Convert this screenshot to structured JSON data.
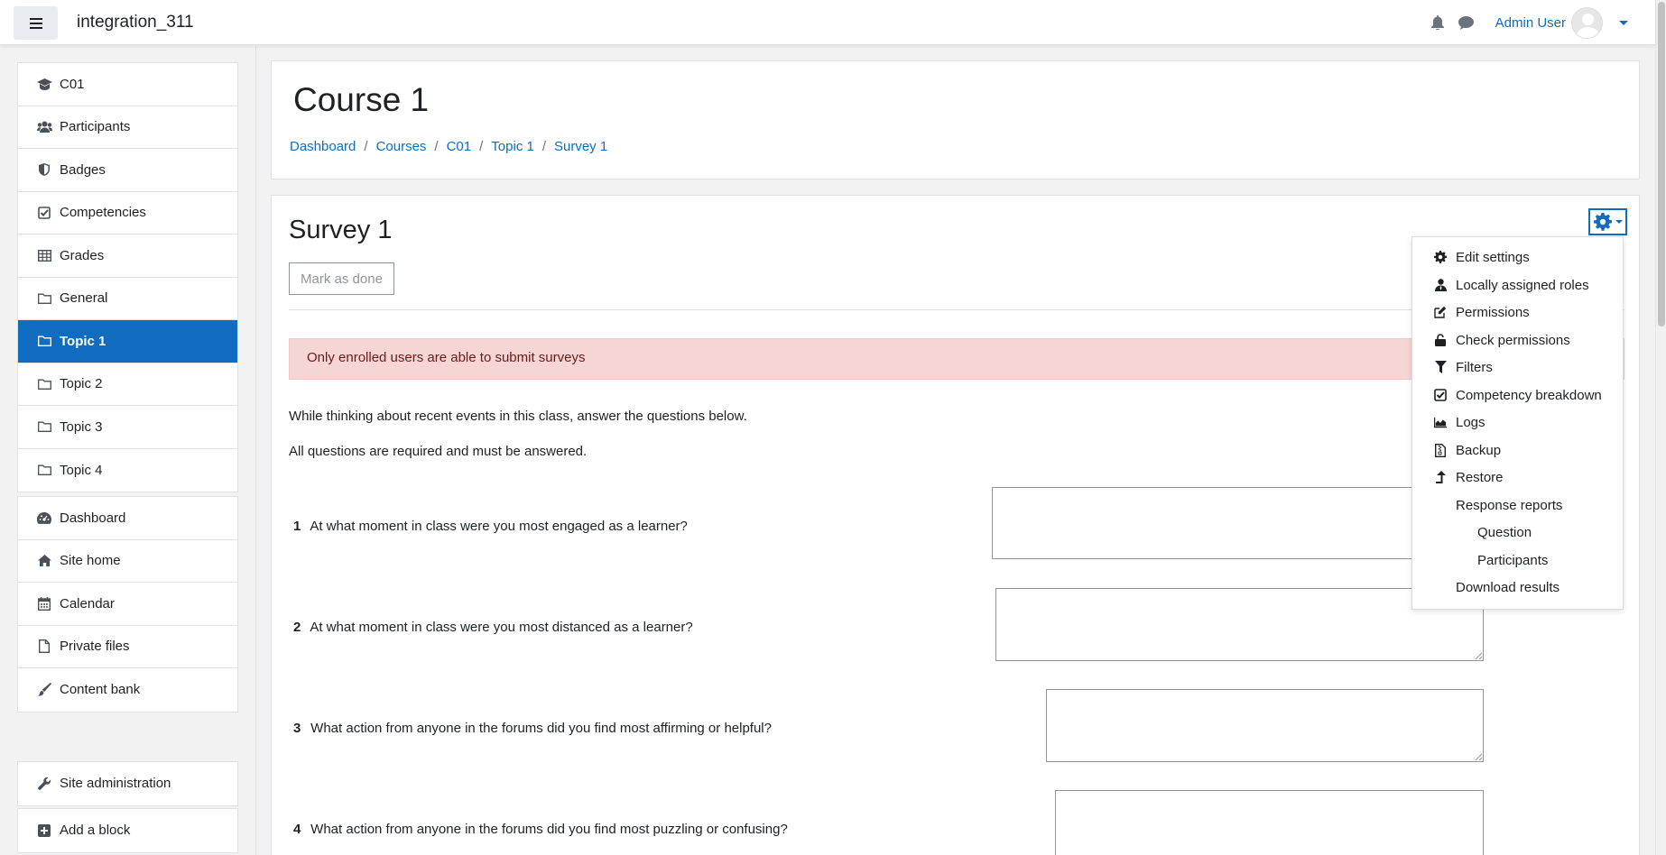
{
  "navbar": {
    "site_name": "integration_311",
    "user_name": "Admin User"
  },
  "sidebar": {
    "course_items": [
      {
        "label": "C01",
        "icon": "graduation-cap-icon"
      },
      {
        "label": "Participants",
        "icon": "users-icon"
      },
      {
        "label": "Badges",
        "icon": "shield-icon"
      },
      {
        "label": "Competencies",
        "icon": "check-square-icon"
      },
      {
        "label": "Grades",
        "icon": "table-icon"
      },
      {
        "label": "General",
        "icon": "folder-icon"
      },
      {
        "label": "Topic 1",
        "icon": "folder-icon",
        "active": true
      },
      {
        "label": "Topic 2",
        "icon": "folder-icon"
      },
      {
        "label": "Topic 3",
        "icon": "folder-icon"
      },
      {
        "label": "Topic 4",
        "icon": "folder-icon"
      }
    ],
    "site_items": [
      {
        "label": "Dashboard",
        "icon": "dashboard-icon"
      },
      {
        "label": "Site home",
        "icon": "home-icon"
      },
      {
        "label": "Calendar",
        "icon": "calendar-icon"
      },
      {
        "label": "Private files",
        "icon": "file-icon"
      },
      {
        "label": "Content bank",
        "icon": "paint-brush-icon"
      }
    ],
    "admin_item": {
      "label": "Site administration",
      "icon": "wrench-icon"
    },
    "add_block": {
      "label": "Add a block",
      "icon": "plus-square-icon"
    }
  },
  "header": {
    "course_title": "Course 1",
    "breadcrumb": [
      "Dashboard",
      "Courses",
      "C01",
      "Topic 1",
      "Survey 1"
    ],
    "separator": "/"
  },
  "main": {
    "survey_title": "Survey 1",
    "mark_done_label": "Mark as done",
    "alert": "Only enrolled users are able to submit surveys",
    "intro_1": "While thinking about recent events in this class, answer the questions below.",
    "intro_2": "All questions are required and must be answered.",
    "questions": [
      {
        "num": "1",
        "text": "At what moment in class were you most engaged as a learner?"
      },
      {
        "num": "2",
        "text": "At what moment in class were you most distanced as a learner?"
      },
      {
        "num": "3",
        "text": "What action from anyone in the forums did you find most affirming or helpful?"
      },
      {
        "num": "4",
        "text": "What action from anyone in the forums did you find most puzzling or confusing?"
      }
    ]
  },
  "gear_menu": {
    "items": [
      {
        "label": "Edit settings",
        "icon": "gear-icon"
      },
      {
        "label": "Locally assigned roles",
        "icon": "user-tie-icon"
      },
      {
        "label": "Permissions",
        "icon": "edit-icon"
      },
      {
        "label": "Check permissions",
        "icon": "unlock-icon"
      },
      {
        "label": "Filters",
        "icon": "filter-icon"
      },
      {
        "label": "Competency breakdown",
        "icon": "check-square-icon"
      },
      {
        "label": "Logs",
        "icon": "area-chart-icon"
      },
      {
        "label": "Backup",
        "icon": "file-archive-icon"
      },
      {
        "label": "Restore",
        "icon": "level-up-icon"
      },
      {
        "label": "Response reports",
        "icon": ""
      },
      {
        "label": "Question",
        "icon": ""
      },
      {
        "label": "Participants",
        "icon": ""
      },
      {
        "label": "Download results",
        "icon": ""
      }
    ]
  },
  "colors": {
    "brand": "#0f6cbf",
    "alert_bg": "#f6d5d5",
    "alert_text": "#6e1a1a"
  }
}
